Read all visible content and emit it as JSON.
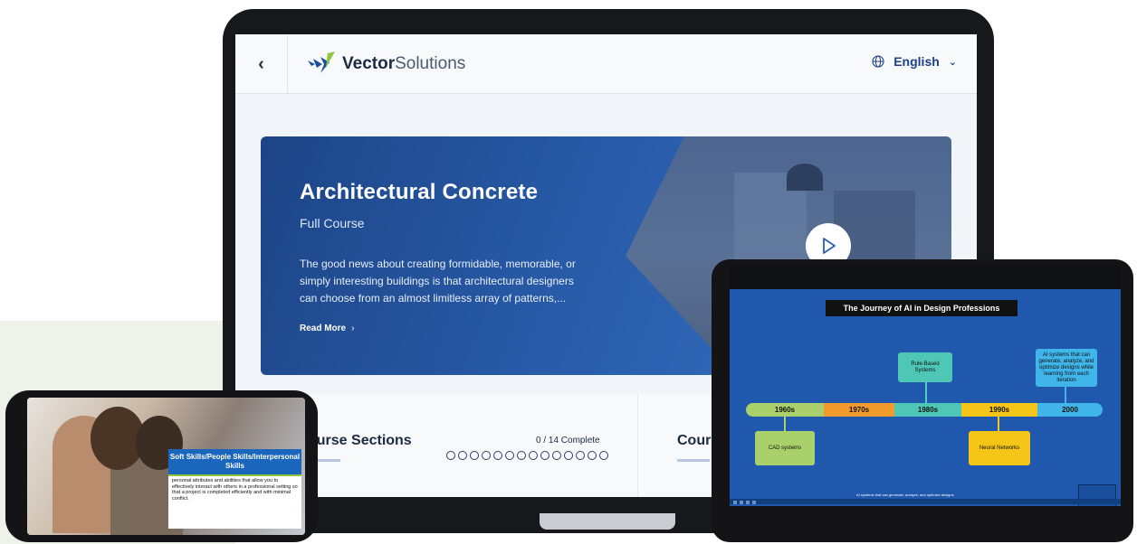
{
  "laptop": {
    "back_icon": "chevron-left-icon",
    "logo": {
      "brand_bold": "Vector",
      "brand_light": "Solutions"
    },
    "language": {
      "label": "English",
      "icon": "globe-icon",
      "caret": "chevron-down-icon"
    },
    "hero": {
      "title": "Architectural Concrete",
      "subtitle": "Full Course",
      "description": "The good news about creating formidable, memorable, or simply interesting buildings is that architectural designers can choose from an almost limitless array of patterns,...",
      "read_more": "Read More",
      "play_icon": "play-icon"
    },
    "sections": {
      "title": "ourse Sections",
      "progress": "0 / 14 Complete",
      "completed": 0,
      "total": 14,
      "second_title": "Cour"
    }
  },
  "tablet": {
    "slide_title": "The Journey of AI in Design Professions",
    "timeline": [
      {
        "label": "1960s",
        "color": "#a9d06b"
      },
      {
        "label": "1970s",
        "color": "#f39a2c"
      },
      {
        "label": "1980s",
        "color": "#4fc7b6"
      },
      {
        "label": "1990s",
        "color": "#f5c518"
      },
      {
        "label": "2000",
        "color": "#3fb5ea"
      }
    ],
    "milestones": {
      "rule_based": "Rule-Based Systems",
      "ai_systems": "AI systems that can generate, analyze, and optimize designs while learning from each iteration",
      "cad": "CAD systems",
      "neural": "Neural Networks"
    },
    "caption": "AI systems that can generate, analyze, and optimize designs"
  },
  "phone": {
    "card_title": "Soft Skills/People Skills/Interpersonal Skills",
    "card_body": "personal attributes and abilities that allow you to effectively interact with others in a professional setting so that a project is completed efficiently and with minimal conflict."
  }
}
